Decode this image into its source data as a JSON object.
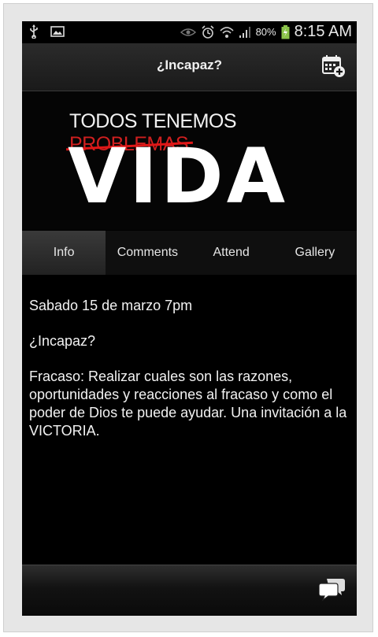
{
  "status_bar": {
    "left_icons": [
      "usb-icon",
      "image-icon"
    ],
    "right_icons": [
      "eye-icon",
      "alarm-icon",
      "wifi-icon",
      "signal-icon"
    ],
    "battery": "80%",
    "time": "8:15 AM"
  },
  "header": {
    "title": "¿Incapaz?",
    "calendar_icon": "calendar-add-icon"
  },
  "banner": {
    "line1_a": "TODOS TENEMOS",
    "line1_b": "PROBLEMAS",
    "big_word": "VIDA"
  },
  "tabs": [
    {
      "label": "Info",
      "active": true
    },
    {
      "label": "Comments",
      "active": false
    },
    {
      "label": "Attend",
      "active": false
    },
    {
      "label": "Gallery",
      "active": false
    }
  ],
  "content": {
    "date": "Sabado 15 de marzo 7pm",
    "subtitle": "¿Incapaz?",
    "description": "Fracaso: Realizar cuales son las razones, oportunidades y reacciones al fracaso y como el poder de Dios te puede ayudar. Una invitación a la VICTORIA."
  },
  "footer": {
    "comment_icon": "comment-icon"
  },
  "colors": {
    "background": "#000000",
    "accent_red": "#e01717"
  }
}
